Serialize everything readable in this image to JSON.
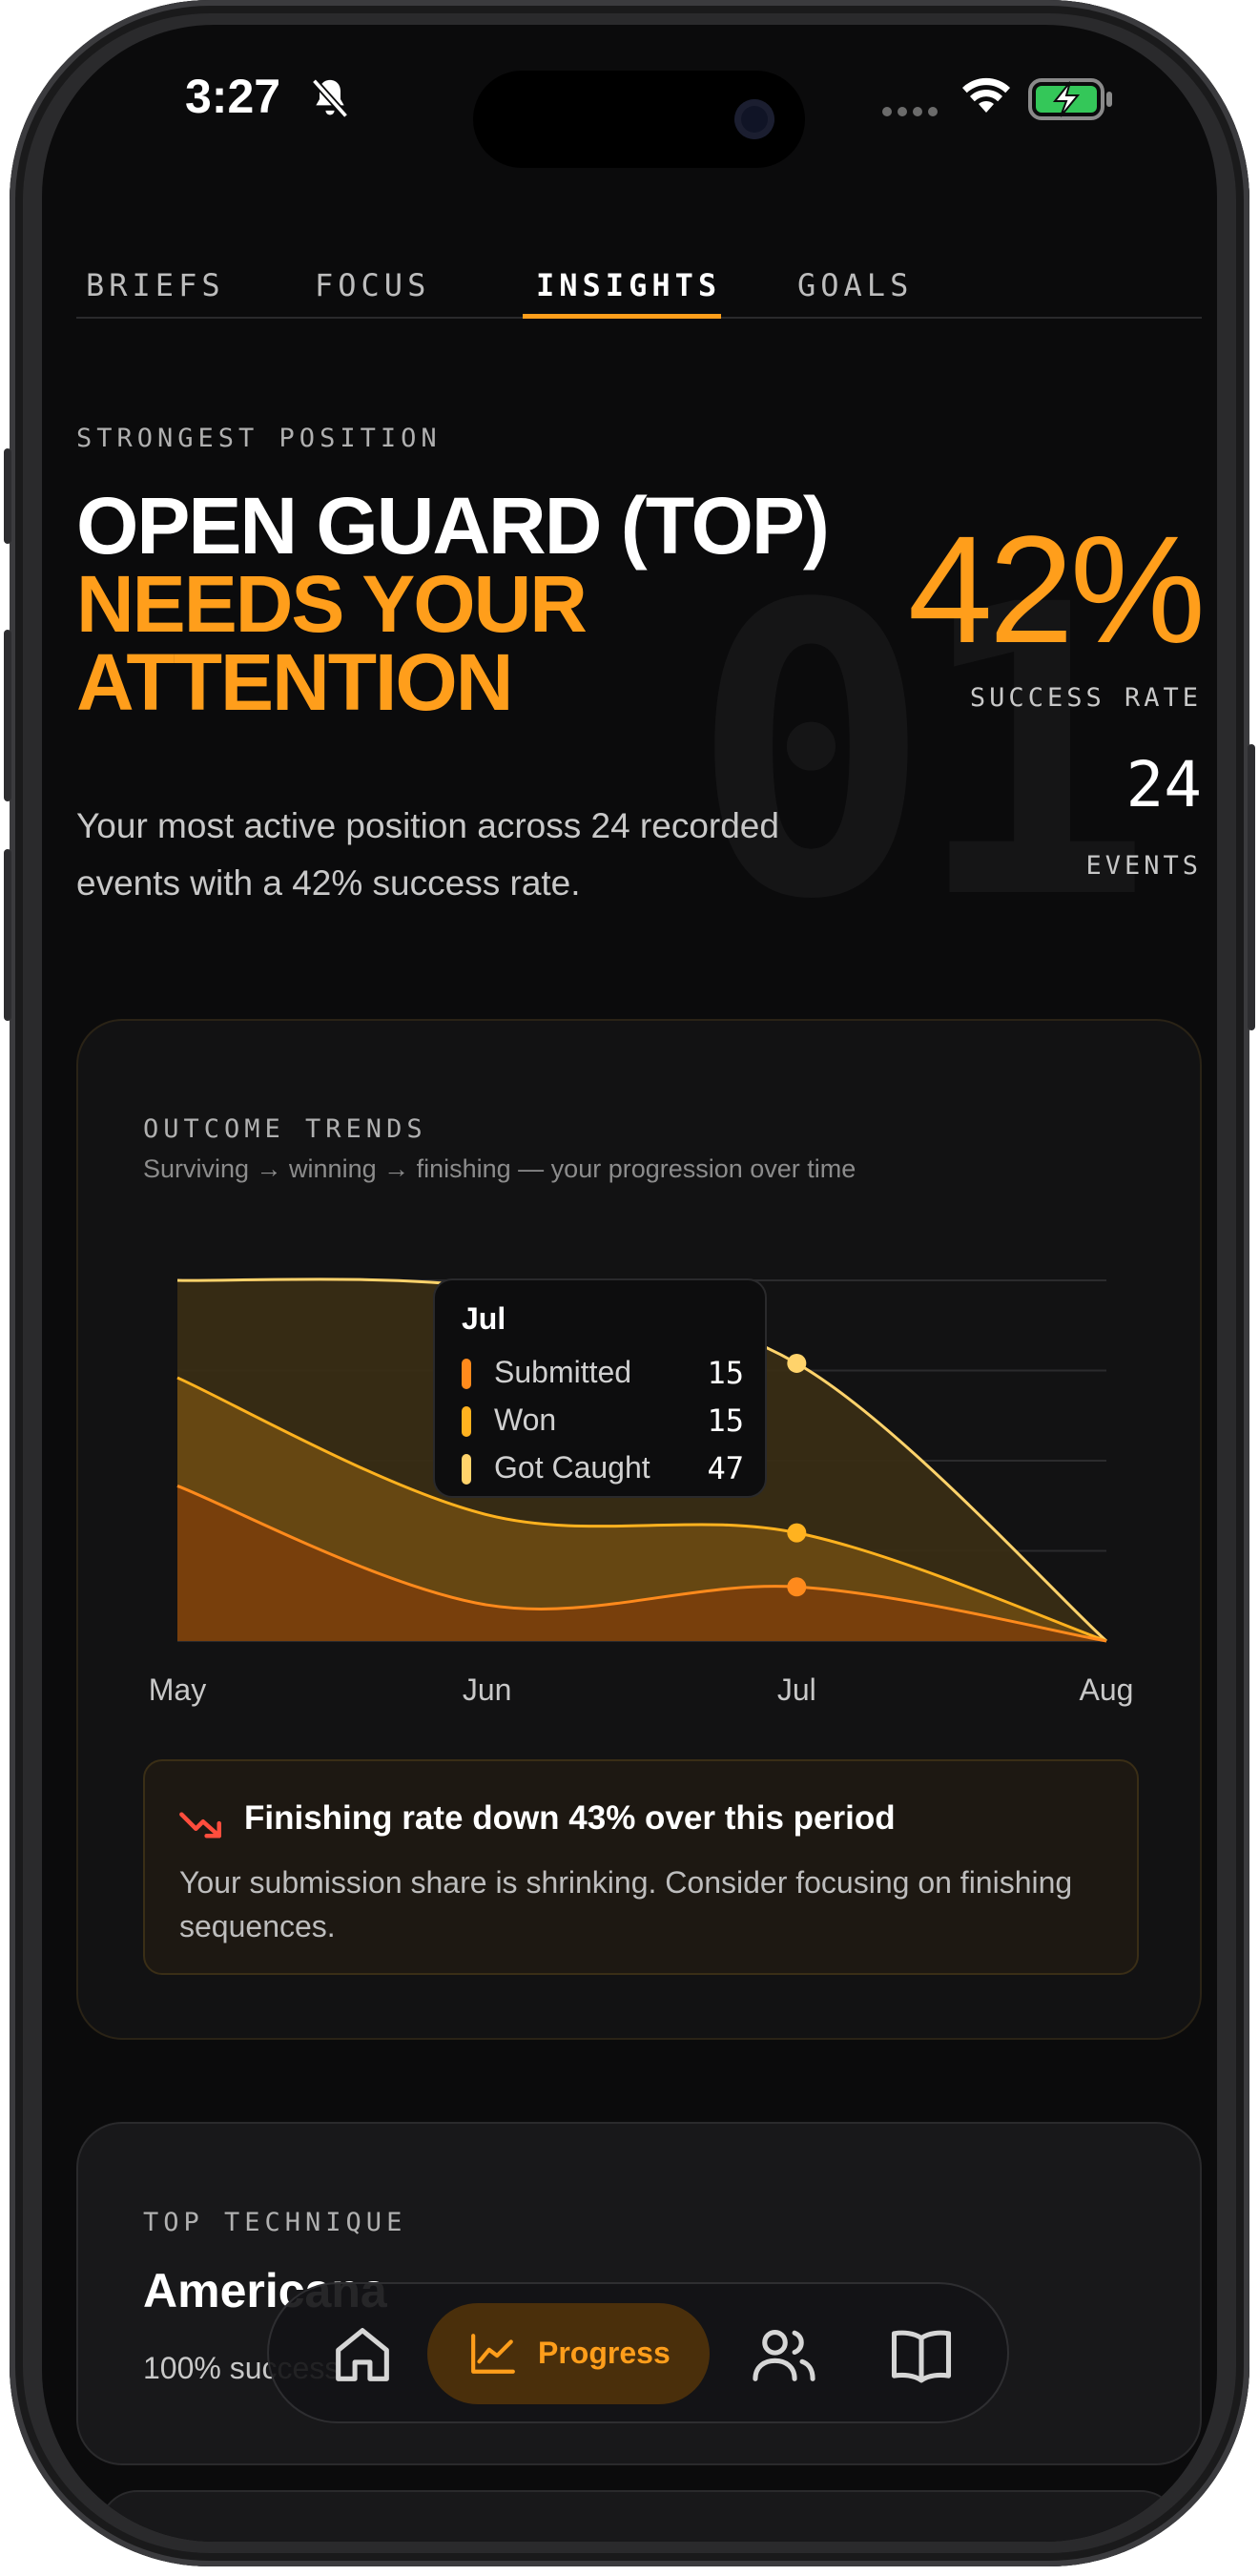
{
  "status_bar": {
    "time": "3:27"
  },
  "tabs": [
    {
      "label": "BRIEFS"
    },
    {
      "label": "FOCUS"
    },
    {
      "label": "INSIGHTS"
    },
    {
      "label": "GOALS"
    }
  ],
  "hero": {
    "eyebrow": "STRONGEST POSITION",
    "title_line": "OPEN GUARD (TOP)",
    "highlight_line1": "NEEDS YOUR",
    "highlight_line2": "ATTENTION",
    "description": "Your most active position across 24 recorded events with a 42% success rate.",
    "success_rate": "42%",
    "success_rate_label": "SUCCESS RATE",
    "events": "24",
    "events_label": "EVENTS",
    "background_number": "01"
  },
  "outcome_trends": {
    "eyebrow": "OUTCOME TRENDS",
    "subtitle": "Surviving → winning → finishing — your progression over time",
    "tooltip": {
      "month": "Jul",
      "rows": [
        {
          "name": "Submitted",
          "value": "15",
          "color": "#ff8a1c"
        },
        {
          "name": "Won",
          "value": "15",
          "color": "#ffb21f"
        },
        {
          "name": "Got Caught",
          "value": "47",
          "color": "#ffd36b"
        }
      ]
    },
    "insight": {
      "title": "Finishing rate down 43% over this period",
      "text": "Your submission share is shrinking. Consider focusing on finishing sequences."
    }
  },
  "chart_data": {
    "type": "area",
    "x": [
      "May",
      "Jun",
      "Jul",
      "Aug"
    ],
    "series": [
      {
        "name": "Submitted",
        "values": [
          43,
          10,
          15,
          0
        ]
      },
      {
        "name": "Won",
        "values": [
          30,
          25,
          15,
          0
        ]
      },
      {
        "name": "Got Caught",
        "values": [
          27,
          63,
          47,
          0
        ]
      }
    ],
    "stacked": true,
    "ylim": [
      0,
      100
    ],
    "grid": true,
    "colors": {
      "submitted": "#ff8a1c",
      "won": "#ffb21f",
      "got_caught": "#ffd36b"
    }
  },
  "top_technique": {
    "eyebrow": "TOP TECHNIQUE",
    "title": "Americana",
    "subtitle": "100% success"
  },
  "bottom_nav": {
    "items": [
      {
        "icon": "home-icon"
      },
      {
        "icon": "progress-chart-icon",
        "label": "Progress"
      },
      {
        "icon": "users-icon"
      },
      {
        "icon": "book-icon"
      }
    ]
  },
  "accent_color": "#ff9e1b"
}
